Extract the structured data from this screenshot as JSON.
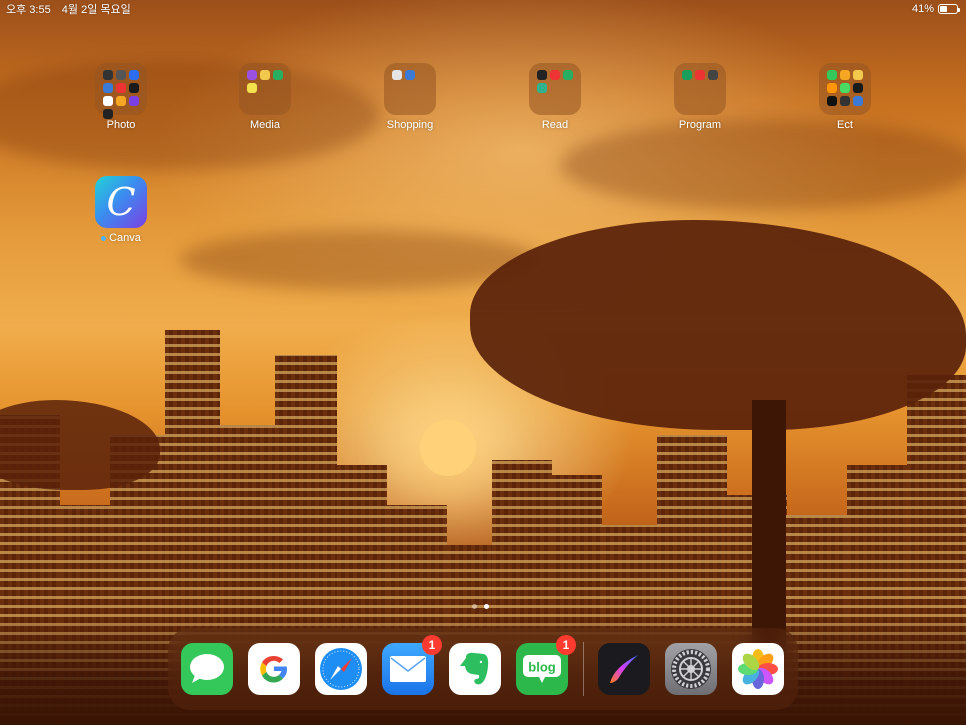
{
  "status_bar": {
    "time": "오후 3:55",
    "date": "4월 2일 목요일",
    "battery_percent_text": "41%",
    "battery_level": 0.41
  },
  "home": {
    "folders": [
      {
        "label": "Photo",
        "minis": [
          "#333333",
          "#555555",
          "#2b6ef0",
          "#3b7bd6",
          "#e33",
          "#1a1a1a",
          "#ffffff",
          "#f5a623",
          "#7b3fe4",
          "#222222"
        ]
      },
      {
        "label": "Media",
        "minis": [
          "#9b51e0",
          "#f2c94c",
          "#27ae60",
          "#f2e14c"
        ]
      },
      {
        "label": "Shopping",
        "minis": [
          "#e5e5e5",
          "#3b7bd6"
        ]
      },
      {
        "label": "Read",
        "minis": [
          "#222222",
          "#e33",
          "#27ae60",
          "#2fb38f"
        ]
      },
      {
        "label": "Program",
        "minis": [
          "#1a9e5c",
          "#e33",
          "#444444"
        ]
      },
      {
        "label": "Ect",
        "minis": [
          "#34c759",
          "#f5a623",
          "#f2c94c",
          "#ff9500",
          "#4cd964",
          "#1a1a1a",
          "#111111",
          "#333333",
          "#3b7bd6"
        ]
      }
    ],
    "apps": [
      {
        "label": "Canva",
        "glyph": "C"
      }
    ]
  },
  "page_indicator": {
    "count": 2,
    "active": 1
  },
  "dock": {
    "apps": [
      {
        "name": "Messages",
        "icon": "messages-icon",
        "bg": "#34c759",
        "badge": ""
      },
      {
        "name": "Google",
        "icon": "google-icon",
        "bg": "#ffffff",
        "badge": "",
        "glyph": "G"
      },
      {
        "name": "Safari",
        "icon": "safari-compass-icon",
        "bg": "#ffffff",
        "badge": ""
      },
      {
        "name": "Mail",
        "icon": "mail-envelope-icon",
        "bg": "#2f8ef4",
        "badge": "1"
      },
      {
        "name": "Evernote",
        "icon": "evernote-elephant-icon",
        "bg": "#ffffff",
        "badge": ""
      },
      {
        "name": "Naver Blog",
        "icon": "blog-speech-icon",
        "bg": "#2db84b",
        "badge": "1",
        "glyph": "blog"
      }
    ],
    "recent_apps": [
      {
        "name": "Procreate",
        "icon": "procreate-brush-icon",
        "bg": "#1b1b1f",
        "badge": ""
      },
      {
        "name": "Settings",
        "icon": "settings-gear-icon",
        "bg": "#8e8e93",
        "badge": ""
      },
      {
        "name": "Photos",
        "icon": "photos-flower-icon",
        "bg": "#ffffff",
        "badge": ""
      }
    ]
  }
}
